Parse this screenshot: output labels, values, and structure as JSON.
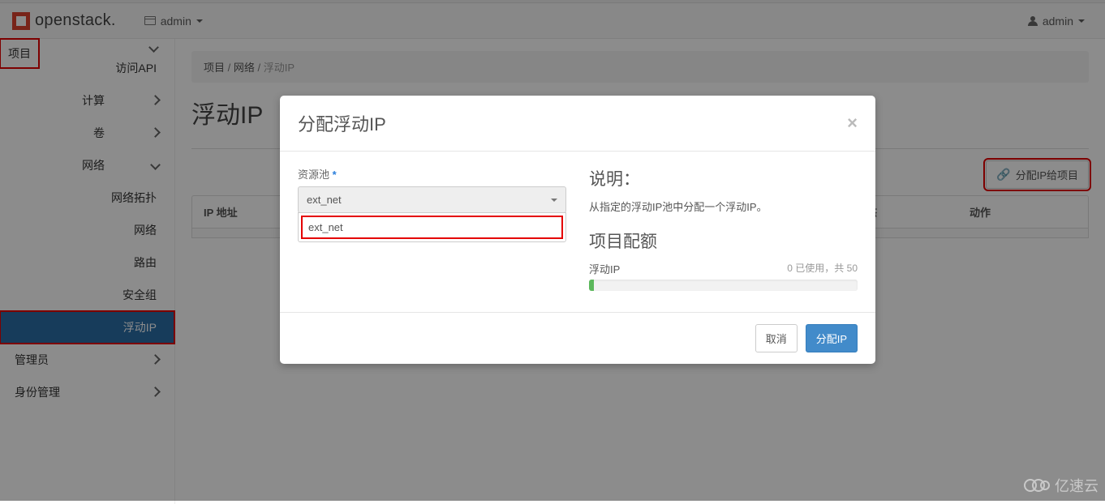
{
  "brand": {
    "name": "openstack."
  },
  "navbar": {
    "domain": "admin",
    "user": "admin"
  },
  "sidebar": {
    "project": "项目",
    "api": "访问API",
    "compute": "计算",
    "volume": "卷",
    "network": "网络",
    "net_children": {
      "topology": "网络拓扑",
      "networks": "网络",
      "routers": "路由",
      "security": "安全组",
      "floating": "浮动IP"
    },
    "admin": "管理员",
    "identity": "身份管理"
  },
  "breadcrumb": {
    "a": "项目",
    "b": "网络",
    "c": "浮动IP"
  },
  "page": {
    "title": "浮动IP",
    "allocate_btn": "分配IP给项目"
  },
  "table": {
    "ip": "IP 地址",
    "status": "状态",
    "action": "动作"
  },
  "modal": {
    "title": "分配浮动IP",
    "pool_label": "资源池",
    "pool_value": "ext_net",
    "option": "ext_net",
    "desc_title": "说明：",
    "desc_text": "从指定的浮动IP池中分配一个浮动IP。",
    "quota_title": "项目配额",
    "quota_sub": "浮动IP",
    "quota_info": "0 已使用，共 50",
    "cancel": "取消",
    "submit": "分配IP"
  },
  "watermark": "亿速云"
}
